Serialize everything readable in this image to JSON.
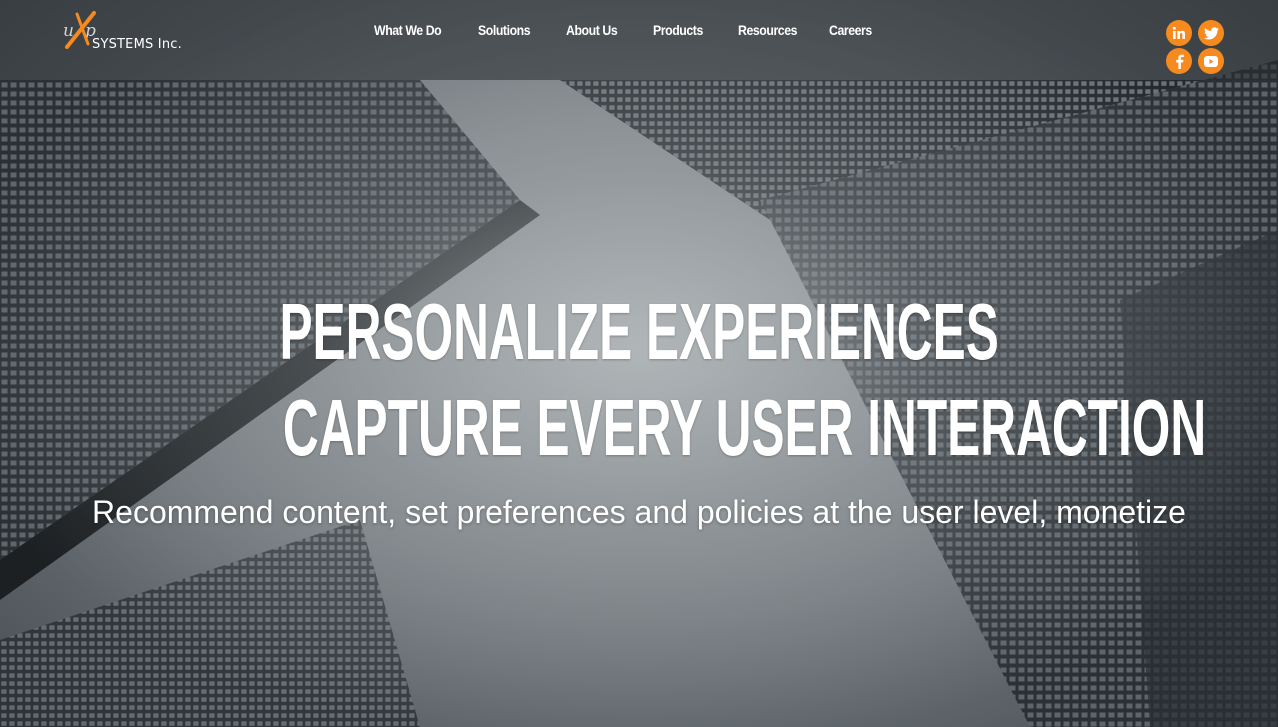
{
  "brand": {
    "logo_mark": "uXp",
    "company_name": "SYSTEMS Inc.",
    "accent_color": "#f68a1e"
  },
  "nav": {
    "items": [
      {
        "label": "What We Do"
      },
      {
        "label": "Solutions"
      },
      {
        "label": "About Us"
      },
      {
        "label": "Products"
      },
      {
        "label": "Resources"
      },
      {
        "label": "Careers"
      }
    ]
  },
  "social": {
    "icons": [
      "linkedin-icon",
      "twitter-icon",
      "facebook-icon",
      "youtube-icon"
    ]
  },
  "hero": {
    "headline_line1": "PERSONALIZE EXPERIENCES",
    "headline_line2": "CAPTURE EVERY USER INTERACTION",
    "subheadline": "Recommend content, set preferences and policies at the user level, monetize"
  }
}
